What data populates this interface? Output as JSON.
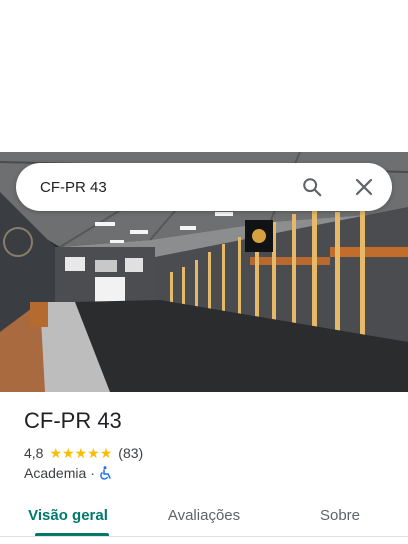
{
  "search": {
    "query": "CF-PR 43"
  },
  "place": {
    "name": "CF-PR 43",
    "rating": "4,8",
    "review_count": "(83)",
    "category": "Academia",
    "separator": "·"
  },
  "tabs": [
    {
      "label": "Visão geral",
      "active": true
    },
    {
      "label": "Avaliações",
      "active": false
    },
    {
      "label": "Sobre",
      "active": false
    }
  ],
  "colors": {
    "accent": "#00796b",
    "star": "#fbbc04",
    "wheelchair": "#1a73e8"
  }
}
